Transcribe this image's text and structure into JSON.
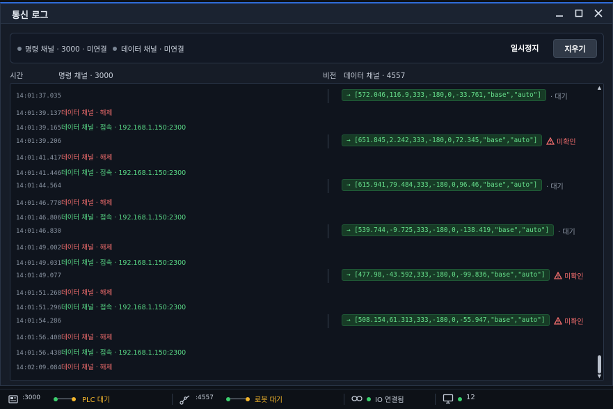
{
  "window": {
    "title": "통신 로그"
  },
  "controls": {
    "cmd_channel": "명령 채널 · 3000 · 미연결",
    "data_channel": "데이터 채널 · 미연결",
    "pause_label": "일시정지",
    "clear_label": "지우기"
  },
  "columns": {
    "time": "시간",
    "cmd": "명령 채널 · 3000",
    "vision": "비전",
    "data": "데이터 채널 · 4557"
  },
  "log": [
    {
      "ts": "14:01:37.035",
      "kind": "data",
      "payload": "→ [572.046,116.9,333,-180,0,-33.761,\"base\",\"auto\"]",
      "status": "· 대기",
      "status_kind": "wait"
    },
    {
      "ts": "14:01:39.137",
      "kind": "off",
      "msg": "데이터 채널 · 해제"
    },
    {
      "ts": "14:01:39.165",
      "kind": "on",
      "msg": "데이터 채널 · 접속 · 192.168.1.150:2300"
    },
    {
      "ts": "14:01:39.206",
      "kind": "data",
      "payload": "→ [651.845,2.242,333,-180,0,72.345,\"base\",\"auto\"]",
      "status": "미확인",
      "status_kind": "warn"
    },
    {
      "ts": "14:01:41.417",
      "kind": "off",
      "msg": "데이터 채널 · 해제"
    },
    {
      "ts": "14:01:41.446",
      "kind": "on",
      "msg": "데이터 채널 · 접속 · 192.168.1.150:2300"
    },
    {
      "ts": "14:01:44.564",
      "kind": "data",
      "payload": "→ [615.941,79.484,333,-180,0,96.46,\"base\",\"auto\"]",
      "status": "· 대기",
      "status_kind": "wait"
    },
    {
      "ts": "14:01:46.778",
      "kind": "off",
      "msg": "데이터 채널 · 해제"
    },
    {
      "ts": "14:01:46.806",
      "kind": "on",
      "msg": "데이터 채널 · 접속 · 192.168.1.150:2300"
    },
    {
      "ts": "14:01:46.830",
      "kind": "data",
      "payload": "→ [539.744,-9.725,333,-180,0,-138.419,\"base\",\"auto\"]",
      "status": "· 대기",
      "status_kind": "wait"
    },
    {
      "ts": "14:01:49.002",
      "kind": "off",
      "msg": "데이터 채널 · 해제"
    },
    {
      "ts": "14:01:49.031",
      "kind": "on",
      "msg": "데이터 채널 · 접속 · 192.168.1.150:2300"
    },
    {
      "ts": "14:01:49.077",
      "kind": "data",
      "payload": "→ [477.98,-43.592,333,-180,0,-99.836,\"base\",\"auto\"]",
      "status": "미확인",
      "status_kind": "warn"
    },
    {
      "ts": "14:01:51.268",
      "kind": "off",
      "msg": "데이터 채널 · 해제"
    },
    {
      "ts": "14:01:51.296",
      "kind": "on",
      "msg": "데이터 채널 · 접속 · 192.168.1.150:2300"
    },
    {
      "ts": "14:01:54.286",
      "kind": "data",
      "payload": "→ [508.154,61.313,333,-180,0,-55.947,\"base\",\"auto\"]",
      "status": "미확인",
      "status_kind": "warn"
    },
    {
      "ts": "14:01:56.408",
      "kind": "off",
      "msg": "데이터 채널 · 해제"
    },
    {
      "ts": "14:01:56.438",
      "kind": "on",
      "msg": "데이터 채널 · 접속 · 192.168.1.150:2300"
    },
    {
      "ts": "14:02:09.084",
      "kind": "off",
      "msg": "데이터 채널 · 해제"
    }
  ],
  "statusbar": {
    "plc_port": ":3000",
    "plc_label": "PLC 대기",
    "robot_port": ":4557",
    "robot_label": "로봇 대기",
    "io_label": "IO 연결됨",
    "count": "12"
  },
  "colors": {
    "accent": "#2f6bd9",
    "ok": "#59d986",
    "error": "#f26d6d",
    "pending": "#f2b52c"
  }
}
